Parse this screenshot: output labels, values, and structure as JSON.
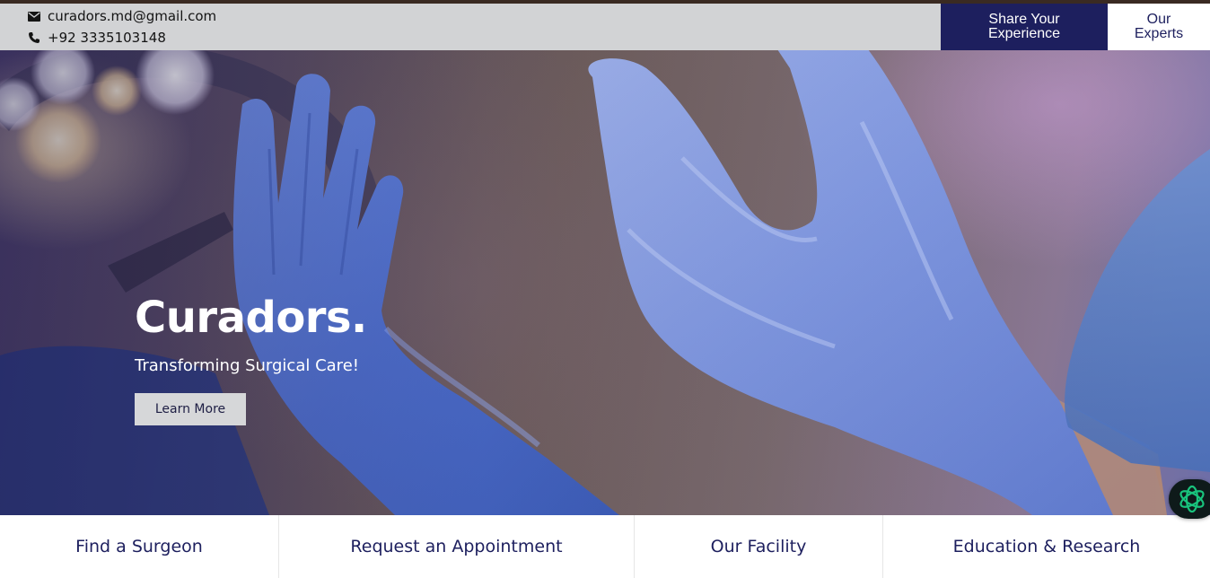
{
  "topbar": {
    "email": "curadors.md@gmail.com",
    "phone": "+92 3335103148",
    "email_icon": "envelope-icon",
    "phone_icon": "phone-icon",
    "share_button_label": "Share Your Experience",
    "experts_button_label": "Our Experts"
  },
  "hero": {
    "title": "Curadors.",
    "subtitle": "Transforming Surgical Care!",
    "cta_label": "Learn More",
    "image_description_icon": "surgical-gloves-image"
  },
  "bottom_nav": {
    "items": [
      {
        "label": "Find a Surgeon"
      },
      {
        "label": "Request an Appointment"
      },
      {
        "label": "Our Facility"
      },
      {
        "label": "Education & Research"
      }
    ]
  },
  "chat_widget": {
    "icon": "chat-assistant-icon"
  },
  "colors": {
    "brand_navy": "#1d1f5e",
    "topbar_gray": "#d2d3d5",
    "top_border": "#3a2a22",
    "cta_bg": "#d6d7d9",
    "chat_bg": "#0e1a1a",
    "chat_accent": "#19c37d"
  }
}
